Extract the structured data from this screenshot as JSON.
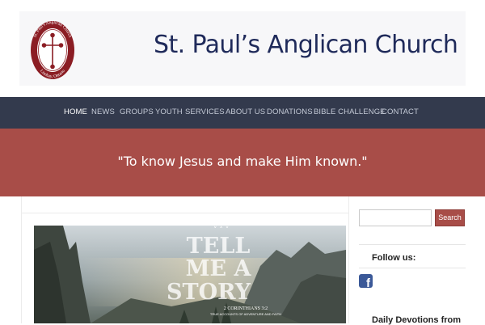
{
  "header": {
    "title": "St. Paul’s Anglican Church",
    "logo": {
      "ring_text_top": "St. Paul's Anglican Church",
      "ring_text_bottom": "Lindsay, Ontario",
      "icon": "cross-icon",
      "color": "#8b1d24"
    }
  },
  "nav": {
    "items": [
      {
        "label": "HOME",
        "active": true
      },
      {
        "label": "NEWS"
      },
      {
        "label": "GROUPS"
      },
      {
        "label": "YOUTH"
      },
      {
        "label": "SERVICES"
      },
      {
        "label": "ABOUT US"
      },
      {
        "label": "DONATIONS"
      },
      {
        "label": "BIBLE CHALLENGE"
      },
      {
        "label": "CONTACT"
      }
    ]
  },
  "hero": {
    "tagline": "\"To know Jesus and make Him known.\""
  },
  "post": {
    "image_title_lines": [
      "TELL",
      "ME A",
      "STORY"
    ],
    "image_caption": "2 CORINTHIANS 3:2",
    "image_subcaption": "TRUE ACCOUNTS OF ADVENTURE AND FAITH"
  },
  "sidebar": {
    "search_placeholder": "",
    "search_button": "Search",
    "follow_title": "Follow us:",
    "facebook_icon": "facebook-icon",
    "devotions_title": "Daily Devotions from"
  },
  "colors": {
    "nav_bg": "#333a4d",
    "hero_bg": "#a84d48",
    "title_color": "#1f2a5a",
    "facebook": "#3b5998"
  }
}
